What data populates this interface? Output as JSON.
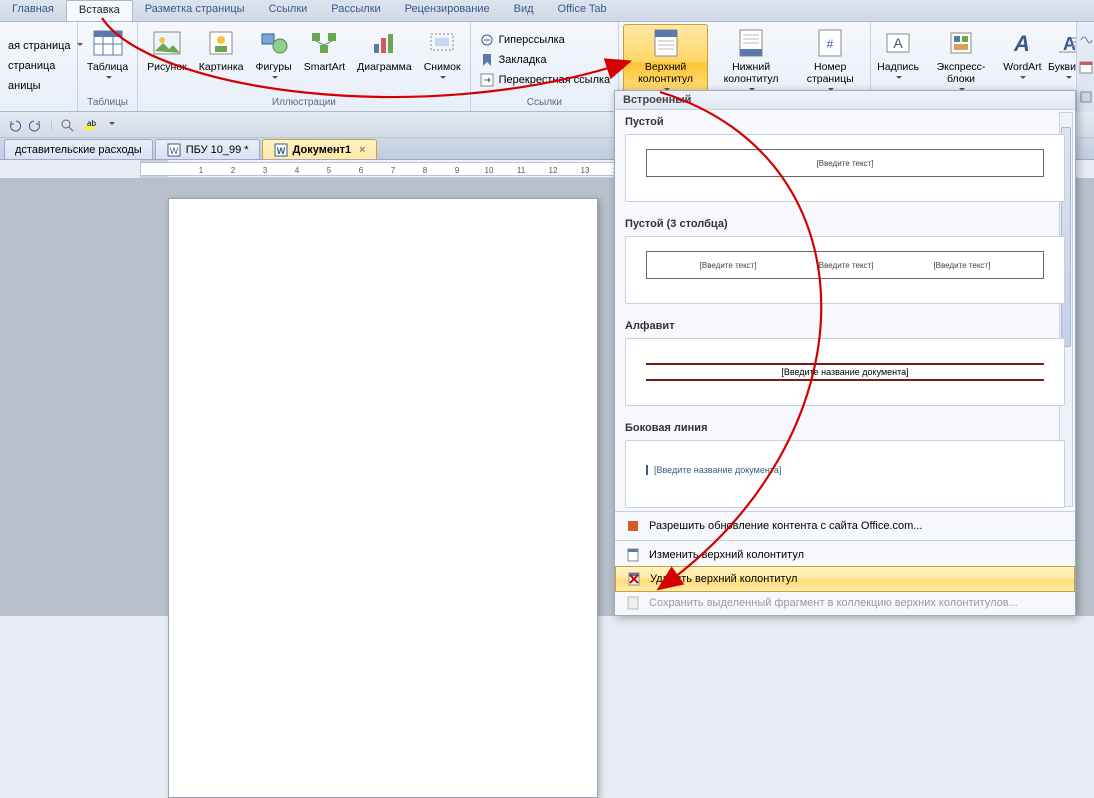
{
  "tabs": {
    "home": "Главная",
    "insert": "Вставка",
    "pagelayout": "Разметка страницы",
    "references": "Ссылки",
    "mailings": "Рассылки",
    "review": "Рецензирование",
    "view": "Вид",
    "officetab": "Office Tab"
  },
  "ribbon": {
    "pages": {
      "cover": "ая страница",
      "blank": "страница",
      "break": "аницы",
      "groupLabel": ""
    },
    "tables": {
      "table": "Таблица",
      "groupLabel": "Таблицы"
    },
    "illustrations": {
      "picture": "Рисунок",
      "clipart": "Картинка",
      "shapes": "Фигуры",
      "smartart": "SmartArt",
      "chart": "Диаграмма",
      "screenshot": "Снимок",
      "groupLabel": "Иллюстрации"
    },
    "links": {
      "hyperlink": "Гиперссылка",
      "bookmark": "Закладка",
      "crossref": "Перекрестная ссылка",
      "groupLabel": "Ссылки"
    },
    "headerfooter": {
      "header": "Верхний колонтитул",
      "footer": "Нижний колонтитул",
      "pagenum": "Номер страницы"
    },
    "text": {
      "textbox": "Надпись",
      "quickparts": "Экспресс-блоки",
      "wordart": "WordArt",
      "dropcap": "Буквица"
    }
  },
  "doctabs": {
    "t1": "дставительские расходы",
    "t2": "ПБУ 10_99 *",
    "t3": "Документ1"
  },
  "gallery": {
    "builtinHeader": "Встроенный",
    "empty": {
      "label": "Пустой",
      "placeholder": "[Введите текст]"
    },
    "empty3": {
      "label": "Пустой (3 столбца)",
      "placeholder": "[Введите текст]"
    },
    "alphabet": {
      "label": "Алфавит",
      "placeholder": "[Введите название документа]"
    },
    "sideline": {
      "label": "Боковая линия",
      "placeholder": "[Введите название документа]"
    },
    "allowUpdate": "Разрешить обновление контента с сайта Office.com...",
    "edit": "Изменить верхний колонтитул",
    "remove": "Удалить верхний колонтитул",
    "saveSelection": "Сохранить выделенный фрагмент в коллекцию верхних колонтитулов..."
  },
  "colors": {
    "highlight": "#ffd86a",
    "accent": "#3a5a8a",
    "arrow": "#d40000"
  }
}
